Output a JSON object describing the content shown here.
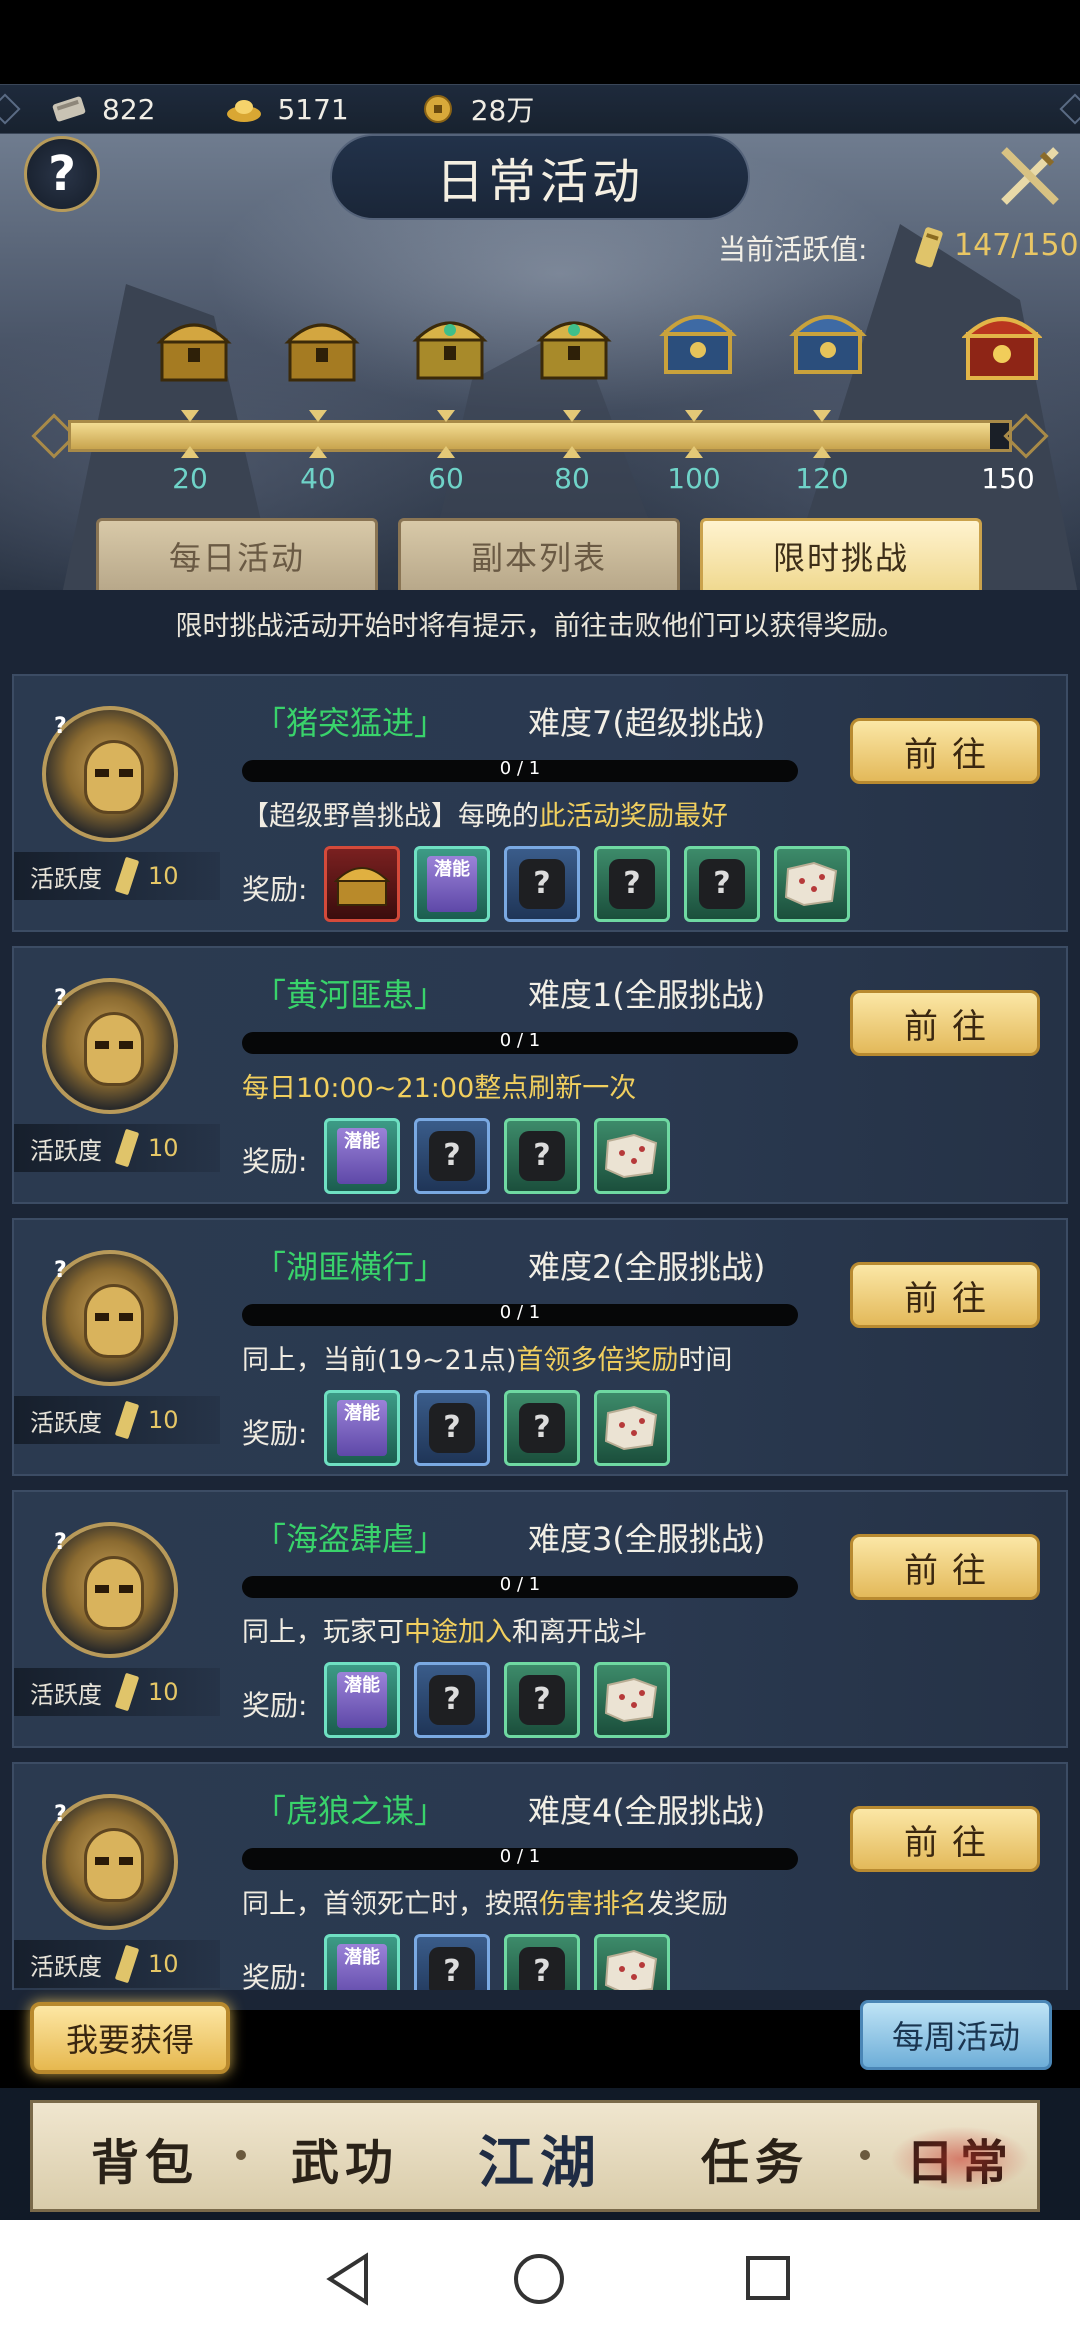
{
  "resources": [
    {
      "icon": "scroll-ticket-icon",
      "value": "822"
    },
    {
      "icon": "gold-ingot-icon",
      "value": "5171"
    },
    {
      "icon": "copper-coin-icon",
      "value": "28万"
    }
  ],
  "header": {
    "title": "日常活动",
    "help": "?",
    "activity_label": "当前活跃值:",
    "activity_value": "147/150"
  },
  "progress": {
    "current": 147,
    "max": 150,
    "milestones": [
      "20",
      "40",
      "60",
      "80",
      "100",
      "120",
      "150"
    ]
  },
  "tabs": [
    {
      "label": "每日活动",
      "active": false
    },
    {
      "label": "副本列表",
      "active": false
    },
    {
      "label": "限时挑战",
      "active": true
    }
  ],
  "notice": "限时挑战活动开始时将有提示，前往击败他们可以获得奖励。",
  "cards": [
    {
      "name": "「猪突猛进」",
      "difficulty": "难度7(超级挑战)",
      "progress": "0 / 1",
      "desc_parts": [
        "【超级野兽挑战】每晚的",
        "此活动奖励最好",
        ""
      ],
      "activity_label": "活跃度",
      "activity_points": "10",
      "reward_label": "奖励:",
      "go_label": "前往",
      "rewards": [
        "treasure-chest",
        "skill-book",
        "mystery-blue",
        "mystery-dark",
        "mystery-green",
        "map"
      ],
      "book_text": "潜能"
    },
    {
      "name": "「黄河匪患」",
      "difficulty": "难度1(全服挑战)",
      "progress": "0 / 1",
      "desc_parts": [
        "",
        "每日10:00~21:00整点刷新一次",
        ""
      ],
      "activity_label": "活跃度",
      "activity_points": "10",
      "reward_label": "奖励:",
      "go_label": "前往",
      "rewards": [
        "skill-book",
        "mystery-blue",
        "mystery-green",
        "map"
      ],
      "book_text": "潜能"
    },
    {
      "name": "「湖匪横行」",
      "difficulty": "难度2(全服挑战)",
      "progress": "0 / 1",
      "desc_parts": [
        "同上，当前(19~21点)",
        "首领多倍奖励",
        "时间"
      ],
      "activity_label": "活跃度",
      "activity_points": "10",
      "reward_label": "奖励:",
      "go_label": "前往",
      "rewards": [
        "skill-book",
        "mystery-blue",
        "mystery-green",
        "map"
      ],
      "book_text": "潜能"
    },
    {
      "name": "「海盗肆虐」",
      "difficulty": "难度3(全服挑战)",
      "progress": "0 / 1",
      "desc_parts": [
        "同上，玩家可",
        "中途加入",
        "和离开战斗"
      ],
      "activity_label": "活跃度",
      "activity_points": "10",
      "reward_label": "奖励:",
      "go_label": "前往",
      "rewards": [
        "skill-book",
        "mystery-blue",
        "mystery-green",
        "map"
      ],
      "book_text": "潜能"
    },
    {
      "name": "「虎狼之谋」",
      "difficulty": "难度4(全服挑战)",
      "progress": "0 / 1",
      "desc_parts": [
        "同上，首领死亡时，按照",
        "伤害排名",
        "发奖励"
      ],
      "activity_label": "活跃度",
      "activity_points": "10",
      "reward_label": "奖励:",
      "go_label": "前往",
      "rewards": [
        "skill-book",
        "mystery-blue",
        "mystery-green",
        "map"
      ],
      "book_text": "潜能"
    }
  ],
  "buttons": {
    "want": "我要获得",
    "weekly": "每周活动"
  },
  "bottom_nav": [
    {
      "label": "背包",
      "key": "bag"
    },
    {
      "label": "武功",
      "key": "martial-arts"
    },
    {
      "label": "江湖",
      "key": "jianghu"
    },
    {
      "label": "任务",
      "key": "quests"
    },
    {
      "label": "日常",
      "key": "daily"
    }
  ],
  "colors": {
    "accent_gold": "#e9c664",
    "boss_name_green": "#39d36b",
    "milestone_teal": "#6fd3c8",
    "panel_bg": "#1b2536"
  }
}
